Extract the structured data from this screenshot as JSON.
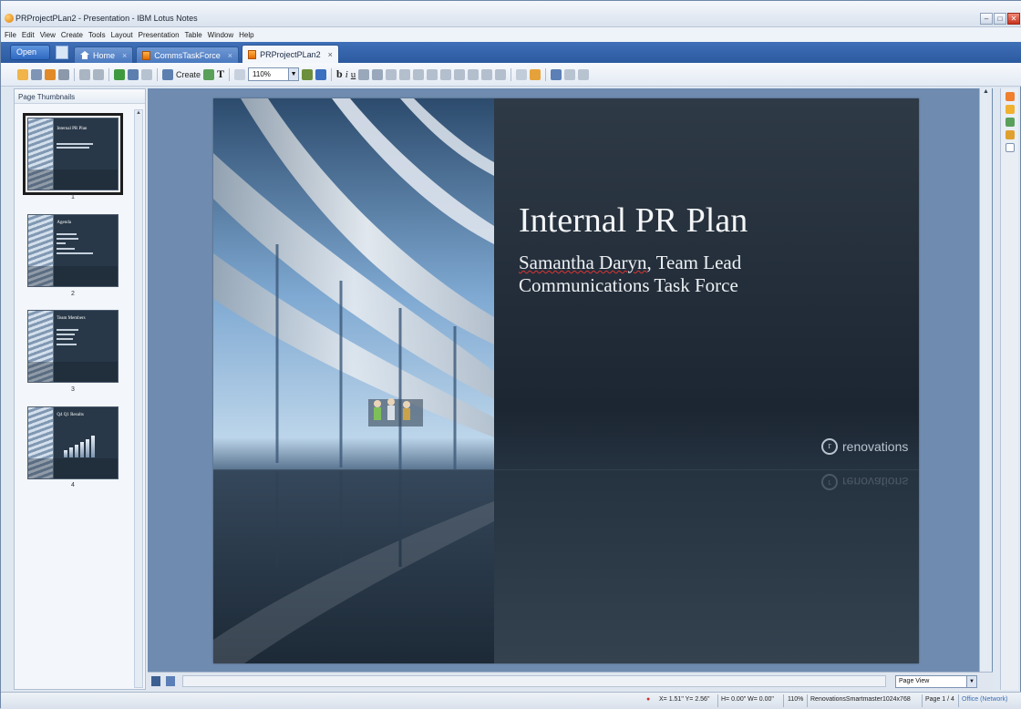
{
  "window": {
    "title": "PRProjectPLan2 - Presentation - IBM Lotus Notes",
    "buttons": [
      "minimize",
      "maximize",
      "close"
    ]
  },
  "menu": [
    "File",
    "Edit",
    "View",
    "Create",
    "Tools",
    "Layout",
    "Presentation",
    "Table",
    "Window",
    "Help"
  ],
  "tabs": {
    "open_label": "Open",
    "items": [
      {
        "label": "Home",
        "icon": "home-icon",
        "active": false
      },
      {
        "label": "CommsTaskForce",
        "icon": "document-icon",
        "active": false
      },
      {
        "label": "PRProjectPLan2",
        "icon": "document-icon",
        "active": true
      }
    ],
    "close_glyph": "×"
  },
  "toolbar": {
    "create_label": "Create",
    "text_tool": "T",
    "zoom": "110%",
    "bold": "b",
    "italic": "i",
    "underline": "u"
  },
  "left_panel": {
    "header": "Page Thumbnails",
    "thumbnails": [
      {
        "number": "1",
        "title": "Internal PR Plan",
        "selected": true
      },
      {
        "number": "2",
        "title": "Agenda",
        "selected": false
      },
      {
        "number": "3",
        "title": "Team Members",
        "selected": false
      },
      {
        "number": "4",
        "title": "Q4 Q1 Results",
        "selected": false
      }
    ]
  },
  "slide": {
    "title": "Internal PR Plan",
    "subtitle_name": "Samantha Daryn",
    "subtitle_rest": ", Team Lead",
    "subtitle_line2": "Communications Task Force",
    "brand_mark": "r",
    "brand": "renovations"
  },
  "canvas_bottom": {
    "view_mode": "Page View"
  },
  "status": {
    "coords": "X= 1.51\"  Y= 2.56\"",
    "size": "H= 0.00\"  W= 0.00\"",
    "zoom": "110%",
    "template": "RenovationsSmartmaster1024x768",
    "page": "Page 1 / 4",
    "location": "Office (Network)"
  },
  "colors": {
    "tab_bar": "#2c5aa0",
    "canvas_bg": "#6f8cb0",
    "slide_bg": "#1c2632"
  }
}
